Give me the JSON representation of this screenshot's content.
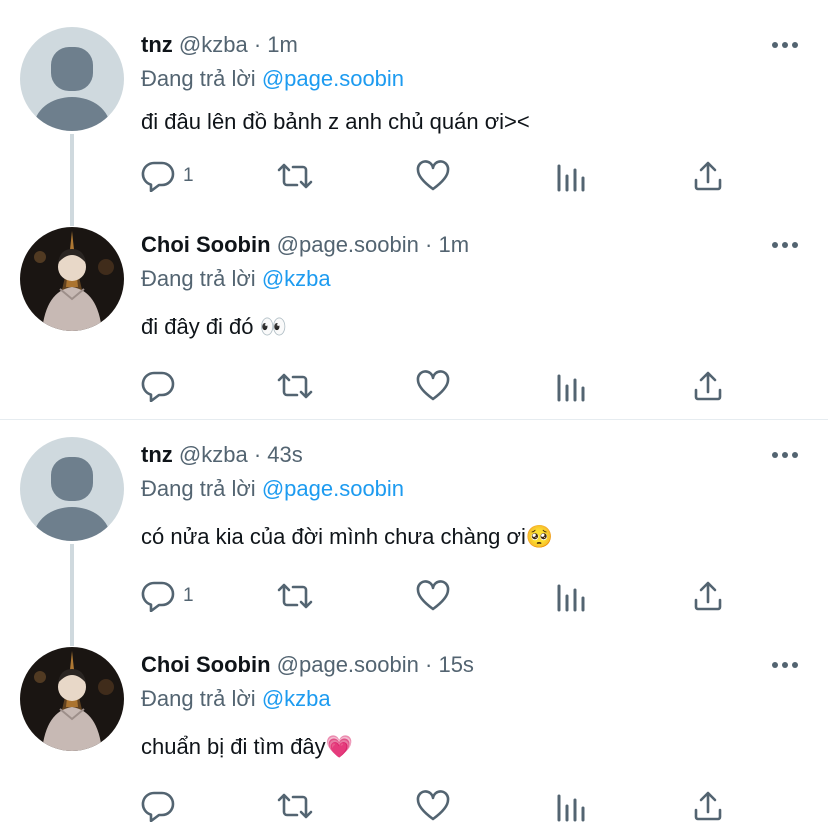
{
  "reply_prefix": "Đang trả lời",
  "more_glyph": "•••",
  "tweets": [
    {
      "name": "tnz",
      "handle": "@kzba",
      "dot": "·",
      "time": "1m",
      "reply_to": "@page.soobin",
      "text": "đi đâu lên đồ bảnh z anh chủ quán ơi><",
      "reply_count": "1",
      "avatar": "default-avatar"
    },
    {
      "name": "Choi Soobin",
      "handle": "@page.soobin",
      "dot": "·",
      "time": "1m",
      "reply_to": "@kzba",
      "text": "đi đây đi đó 👀",
      "reply_count": "",
      "avatar": "photo-avatar"
    },
    {
      "name": "tnz",
      "handle": "@kzba",
      "dot": "·",
      "time": "43s",
      "reply_to": "@page.soobin",
      "text": "có nửa kia của đời mình chưa chàng ơi🥺",
      "reply_count": "1",
      "avatar": "default-avatar"
    },
    {
      "name": "Choi Soobin",
      "handle": "@page.soobin",
      "dot": "·",
      "time": "15s",
      "reply_to": "@kzba",
      "text": "chuẩn bị đi tìm đây💗",
      "reply_count": "",
      "avatar": "photo-avatar"
    }
  ],
  "colors": {
    "accent": "#1d9bf0",
    "secondary_text": "#536471",
    "icon": "#536471",
    "thread_line": "#cfd9de"
  },
  "icons": [
    "reply-icon",
    "retweet-icon",
    "like-icon",
    "analytics-icon",
    "share-icon",
    "more-icon"
  ]
}
